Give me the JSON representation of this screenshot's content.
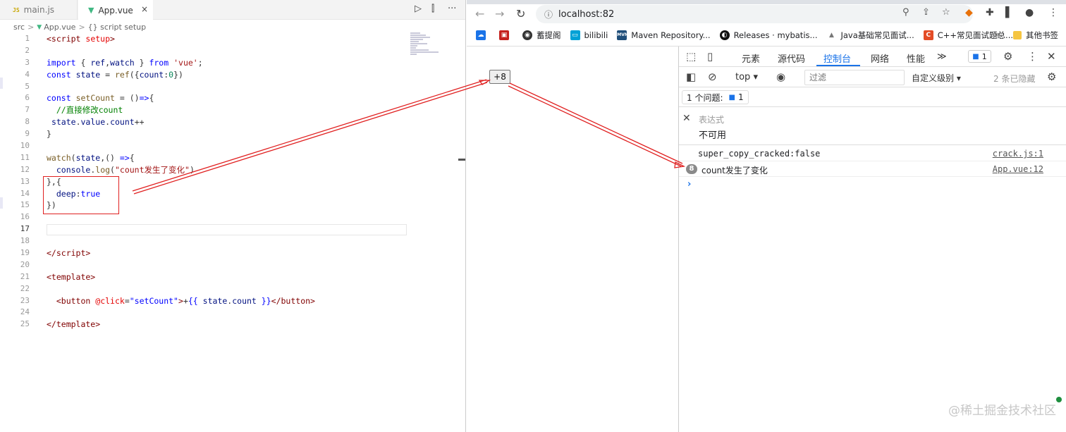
{
  "editor": {
    "tabs": [
      {
        "icon_label": "JS",
        "label": "main.js"
      },
      {
        "icon": "vue-icon",
        "label": "App.vue",
        "close": "×"
      }
    ],
    "actions": [
      "▷",
      "⫿",
      "···"
    ],
    "breadcrumb": {
      "root": "src",
      "sep": ">",
      "file": "App.vue",
      "symbol": "{} script setup"
    },
    "current_line": 17
  },
  "browser": {
    "nav": {
      "back": "←",
      "forward": "→",
      "reload": "↻"
    },
    "url": "localhost:82",
    "bookmarks": [
      {
        "icon": "cloud",
        "color": "#1a73e8",
        "label": ""
      },
      {
        "icon": "cube",
        "color": "#c5221f",
        "label": ""
      },
      {
        "icon": "circle",
        "color": "#333333",
        "label": "蓄提阁"
      },
      {
        "icon": "tv",
        "color": "#00a1d6",
        "label": "bilibili"
      },
      {
        "icon": "mvn",
        "color": "#1f4e79",
        "label": "Maven Repository..."
      },
      {
        "icon": "github",
        "color": "#111111",
        "label": "Releases · mybatis..."
      },
      {
        "icon": "triangle",
        "color": "#777777",
        "label": "Java基础常见面试..."
      },
      {
        "icon": "C",
        "color": "#e34c26",
        "label": "C++常见面试题总..."
      }
    ],
    "bookmarks_more": "»",
    "other_bookmarks": "其他书签",
    "page": {
      "button_text": "+8"
    },
    "devtools": {
      "tabs": [
        "元素",
        "源代码",
        "控制台",
        "网络",
        "性能"
      ],
      "more_tabs": "≫",
      "issues_badge": "1",
      "context": "top",
      "filter_placeholder": "过滤",
      "levels": "自定义级别",
      "hidden": "2 条已隐藏",
      "issues_label": "1 个问题:",
      "issues_count": "1",
      "expression_label": "表达式",
      "expression_value": "不可用",
      "logs": [
        {
          "text": "super_copy_cracked:false",
          "source": "crack.js:1"
        },
        {
          "repeat": "8",
          "text": "count发生了变化",
          "source": "App.vue:12"
        }
      ],
      "prompt": "›"
    },
    "watermark": "@稀土掘金技术社区"
  },
  "colors": {
    "accent": "#1a73e8",
    "annotation": "#e02020",
    "vue": "#41b883"
  }
}
